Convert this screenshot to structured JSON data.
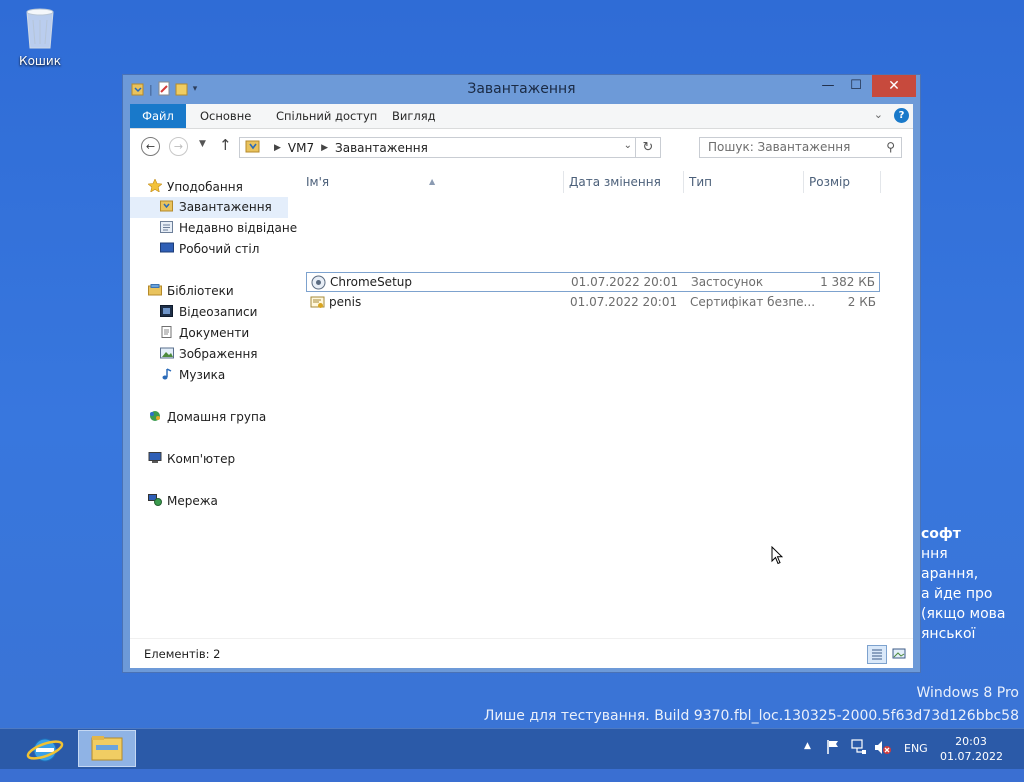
{
  "desktop": {
    "recycle_bin_label": "Кошик"
  },
  "window": {
    "title": "Завантаження",
    "controls": {
      "minimize": "—",
      "maximize": "☐",
      "close": "✕"
    }
  },
  "ribbon": {
    "tabs": [
      "Файл",
      "Основне",
      "Спільний доступ",
      "Вигляд"
    ],
    "help_label": "?"
  },
  "navbar": {
    "path": [
      "VM7",
      "Завантаження"
    ],
    "search_placeholder": "Пошук: Завантаження"
  },
  "navigation_pane": {
    "favorites_label": "Уподобання",
    "favorites": [
      "Завантаження",
      "Недавно відвідане",
      "Робочий стіл"
    ],
    "libraries_label": "Бібліотеки",
    "libraries": [
      "Відеозаписи",
      "Документи",
      "Зображення",
      "Музика"
    ],
    "homegroup_label": "Домашня група",
    "computer_label": "Комп'ютер",
    "network_label": "Мережа"
  },
  "file_list": {
    "columns": [
      "Ім'я",
      "Дата змінення",
      "Тип",
      "Розмір"
    ],
    "rows": [
      {
        "name": "ChromeSetup",
        "date": "01.07.2022 20:01",
        "type": "Застосунок",
        "size": "1 382 КБ"
      },
      {
        "name": "penis",
        "date": "01.07.2022 20:01",
        "type": "Сертифікат безпе...",
        "size": "2 КБ"
      }
    ]
  },
  "status_bar": {
    "item_count": "Елементів: 2"
  },
  "notification_fragment": [
    "софт",
    "ння",
    "арання,",
    "а йде про",
    " (якщо мова",
    "янської"
  ],
  "watermark": {
    "edition": "Windows 8 Pro",
    "build": "Лише для тестування. Build 9370.fbl_loc.130325-2000.5f63d73d126bbc58"
  },
  "taskbar": {
    "language": "ENG",
    "time": "20:03",
    "date": "01.07.2022"
  },
  "colors": {
    "desktop": "#3a6fd2",
    "window_frame": "#6d9ad8",
    "file_tab": "#1979ca",
    "close_button": "#c74a3d",
    "taskbar": "#2b5aa8"
  }
}
